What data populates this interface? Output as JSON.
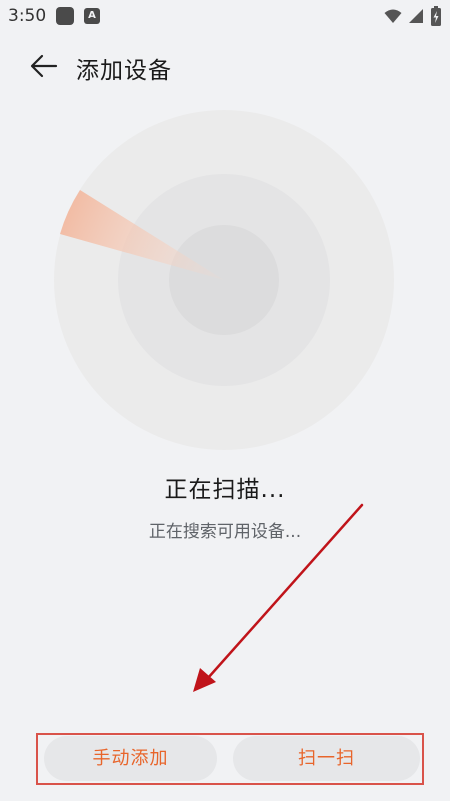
{
  "status_bar": {
    "time": "3:50",
    "app_badge": "A"
  },
  "header": {
    "title": "添加设备"
  },
  "scan": {
    "title": "正在扫描...",
    "subtitle": "正在搜索可用设备..."
  },
  "actions": {
    "manual_add": "手动添加",
    "scan_code": "扫一扫"
  },
  "colors": {
    "accent": "#e8652b",
    "annotation": "#c0141a",
    "background": "#f1f2f4"
  },
  "icons": {
    "back": "arrow-left-icon",
    "wifi": "wifi-icon",
    "signal": "signal-icon",
    "battery": "battery-charging-icon"
  }
}
